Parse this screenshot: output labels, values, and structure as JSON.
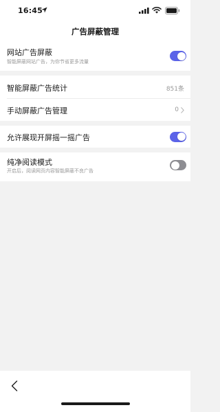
{
  "status_bar": {
    "time": "16:45",
    "icons": [
      "location-arrow-icon",
      "signal-icon",
      "wifi-icon",
      "battery-icon"
    ]
  },
  "nav": {
    "title": "广告屏蔽管理"
  },
  "settings": {
    "website_ad_block": {
      "title": "网站广告屏蔽",
      "subtitle": "智能屏蔽网站广告，为你节省更多流量",
      "enabled": true
    },
    "smart_block_stats": {
      "title": "智能屏蔽广告统计",
      "value": "851条"
    },
    "manual_block_manage": {
      "title": "手动屏蔽广告管理",
      "value": "0"
    },
    "allow_shake_ads": {
      "title": "允许展现开屏摇一摇广告",
      "enabled": true
    },
    "pure_reading": {
      "title": "纯净阅读模式",
      "subtitle": "开启后，阅读网页内容智能屏蔽不良广告",
      "enabled": false
    }
  },
  "colors": {
    "toggle_on": "#5b63e8",
    "toggle_off": "#8e8e93",
    "background": "#f2f2f2"
  },
  "bottom_bar": {
    "back_icon": "chevron-left-icon"
  }
}
